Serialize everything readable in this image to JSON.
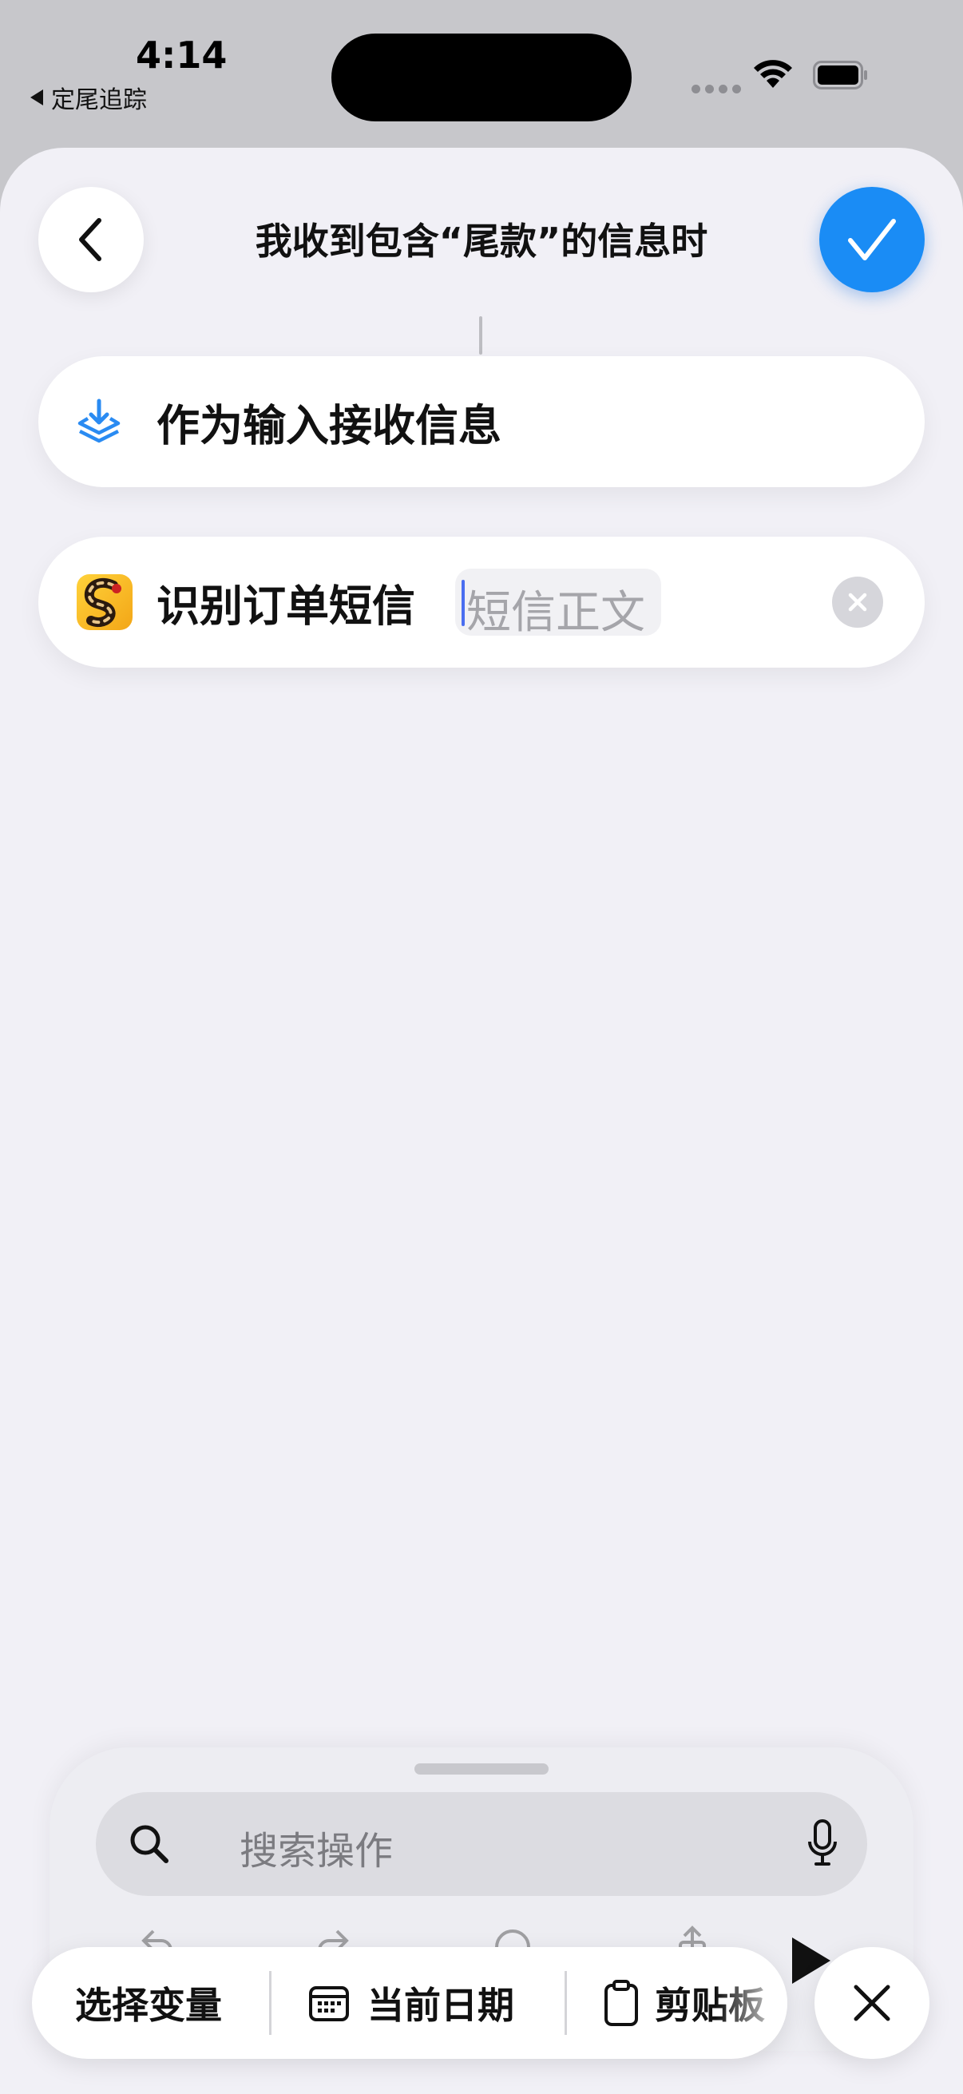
{
  "status_bar": {
    "time": "4:14",
    "back_app_label": "定尾追踪"
  },
  "header": {
    "title": "我收到包含“尾款”的信息时"
  },
  "actions": [
    {
      "label": "作为输入接收信息",
      "icon": "receive-input-icon"
    },
    {
      "label": "识别订单短信",
      "icon": "app-icon",
      "token_placeholder": "短信正文"
    }
  ],
  "search": {
    "placeholder": "搜索操作"
  },
  "bottom_bar": {
    "select_variable": "选择变量",
    "current_date": "当前日期",
    "clipboard": "剪贴板"
  },
  "colors": {
    "accent": "#1a8cf5",
    "background": "#f1f0f6"
  }
}
